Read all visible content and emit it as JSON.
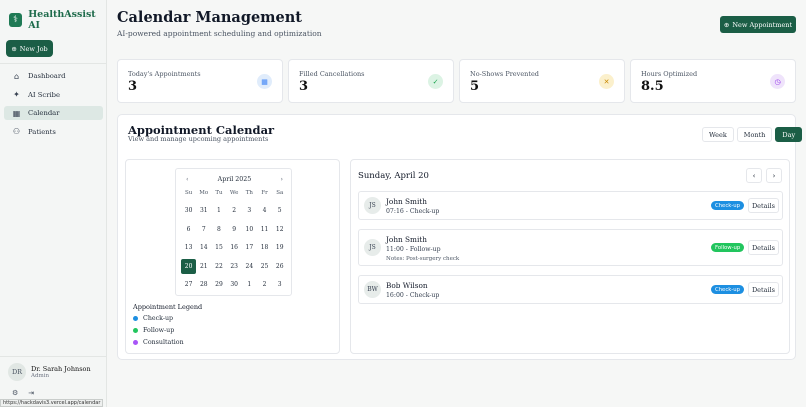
{
  "app": {
    "name": "HealthAssist AI",
    "new_job_label": "New Job"
  },
  "sidebar": {
    "items": [
      {
        "label": "Dashboard",
        "icon": "home-icon",
        "glyph": "⌂"
      },
      {
        "label": "AI Scribe",
        "icon": "sparkles-icon",
        "glyph": "✦"
      },
      {
        "label": "Calendar",
        "icon": "calendar-icon",
        "glyph": "▦",
        "active": true
      },
      {
        "label": "Patients",
        "icon": "users-icon",
        "glyph": "⚇"
      }
    ]
  },
  "user": {
    "initials": "DR",
    "name": "Dr. Sarah Johnson",
    "role": "Admin"
  },
  "status_url": "https://hackdavis3.vercel.app/calendar",
  "header": {
    "title": "Calendar Management",
    "subtitle": "AI-powered appointment scheduling and optimization",
    "new_appointment_label": "New Appointment"
  },
  "stats": [
    {
      "label": "Today's Appointments",
      "value": "3",
      "icon": "calendar-icon",
      "color": "#3b82f6",
      "bg": "#e0ecfb"
    },
    {
      "label": "Filled Cancellations",
      "value": "3",
      "icon": "user-check-icon",
      "color": "#16a34a",
      "bg": "#dcf3e4"
    },
    {
      "label": "No-Shows Prevented",
      "value": "5",
      "icon": "user-x-icon",
      "color": "#ca8a04",
      "bg": "#fbf0cc"
    },
    {
      "label": "Hours Optimized",
      "value": "8.5",
      "icon": "clock-icon",
      "color": "#9333ea",
      "bg": "#efe3fb"
    }
  ],
  "calendar": {
    "title": "Appointment Calendar",
    "subtitle": "View and manage upcoming appointments",
    "views": [
      "Week",
      "Month",
      "Day"
    ],
    "active_view": "Day",
    "month_label": "April 2025",
    "weekdays": [
      "Su",
      "Mo",
      "Tu",
      "We",
      "Th",
      "Fr",
      "Sa"
    ],
    "weeks": [
      [
        "30",
        "31",
        "1",
        "2",
        "3",
        "4",
        "5"
      ],
      [
        "6",
        "7",
        "8",
        "9",
        "10",
        "11",
        "12"
      ],
      [
        "13",
        "14",
        "15",
        "16",
        "17",
        "18",
        "19"
      ],
      [
        "20",
        "21",
        "22",
        "23",
        "24",
        "25",
        "26"
      ],
      [
        "27",
        "28",
        "29",
        "30",
        "1",
        "2",
        "3"
      ]
    ],
    "selected_day": "20",
    "legend_title": "Appointment Legend",
    "legend": [
      {
        "label": "Check-up",
        "color": "#1d8fe1"
      },
      {
        "label": "Follow-up",
        "color": "#22c55e"
      },
      {
        "label": "Consultation",
        "color": "#a855f7"
      }
    ]
  },
  "day_view": {
    "title": "Sunday, April 20",
    "details_label": "Details",
    "appointments": [
      {
        "initials": "JS",
        "name": "John Smith",
        "time": "07:16 - Check-up",
        "type": "Check-up",
        "color": "#1d8fe1",
        "notes": ""
      },
      {
        "initials": "JS",
        "name": "John Smith",
        "time": "11:00 - Follow-up",
        "type": "Follow-up",
        "color": "#22c55e",
        "notes": "Notes: Post-surgery check"
      },
      {
        "initials": "BW",
        "name": "Bob Wilson",
        "time": "16:00 - Check-up",
        "type": "Check-up",
        "color": "#1d8fe1",
        "notes": ""
      }
    ]
  }
}
